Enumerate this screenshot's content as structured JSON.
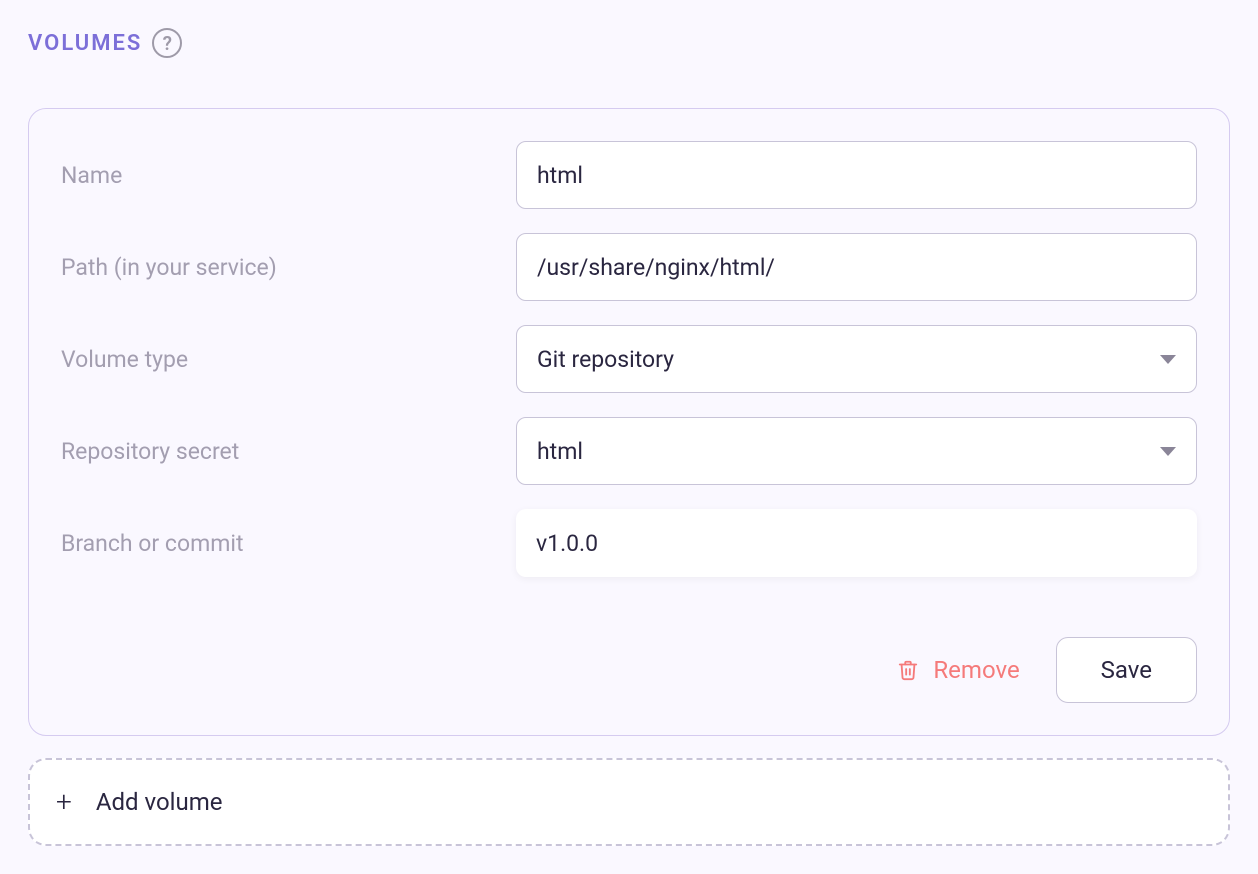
{
  "section": {
    "title": "VOLUMES"
  },
  "form": {
    "name": {
      "label": "Name",
      "value": "html"
    },
    "path": {
      "label": "Path (in your service)",
      "value": "/usr/share/nginx/html/"
    },
    "volumeType": {
      "label": "Volume type",
      "selected": "Git repository"
    },
    "repositorySecret": {
      "label": "Repository secret",
      "selected": "html"
    },
    "branch": {
      "label": "Branch or commit",
      "value": "v1.0.0"
    }
  },
  "actions": {
    "remove": "Remove",
    "save": "Save",
    "addVolume": "Add volume"
  }
}
